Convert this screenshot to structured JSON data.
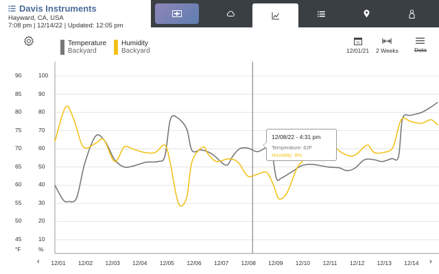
{
  "header": {
    "app_title": "Davis Instruments",
    "location": "Hayward, CA, USA",
    "time": "7:08 pm",
    "date": "12/14/22",
    "updated_label": "Updated: 12:05 pm",
    "sep": "|"
  },
  "nav": {
    "tabs": [
      {
        "icon": "dashboard-icon",
        "active": false
      },
      {
        "icon": "weather-cloud-icon",
        "active": false
      },
      {
        "icon": "graph-icon",
        "active": true
      },
      {
        "icon": "list-icon",
        "active": false
      },
      {
        "icon": "map-pin-icon",
        "active": false
      },
      {
        "icon": "user-icon",
        "active": false
      }
    ]
  },
  "legend": {
    "temperature": {
      "name": "Temperature",
      "location": "Backyard",
      "color": "#777777"
    },
    "humidity": {
      "name": "Humidity",
      "location": "Backyard",
      "color": "#f2c21b"
    }
  },
  "controls": {
    "start_date": "12/01/21",
    "range": "2 Weeks",
    "data_label": "Data"
  },
  "tooltip": {
    "title": "12/08/22 - 4:31 pm",
    "temperature": "Temperature: 62F",
    "humidity": "Humidity: 8%"
  },
  "axes": {
    "temp_unit": "°F",
    "hum_unit": "%"
  },
  "chart_data": {
    "type": "line",
    "x_start": "12/01",
    "x_end": "12/14",
    "categories": [
      "12/01",
      "12/02",
      "12/03",
      "12/04",
      "12/05",
      "12/06",
      "12/07",
      "12/08",
      "12/09",
      "12/10",
      "12/11",
      "12/12",
      "12/13",
      "12/14"
    ],
    "y_left_ticks": [
      45,
      50,
      55,
      60,
      65,
      70,
      75,
      80,
      85,
      90
    ],
    "y_right_ticks": [
      10,
      20,
      30,
      40,
      50,
      60,
      70,
      80,
      90,
      100
    ],
    "ylim_temp": [
      42.5,
      90
    ],
    "ylim_hum": [
      5,
      100
    ],
    "cursor_x": "12/08",
    "series": [
      {
        "name": "Temperature",
        "color": "#777777",
        "points": [
          [
            0,
            60
          ],
          [
            0.3,
            56
          ],
          [
            0.5,
            55.5
          ],
          [
            0.8,
            56.5
          ],
          [
            1.1,
            66
          ],
          [
            1.5,
            73.5
          ],
          [
            1.85,
            72
          ],
          [
            2.2,
            67
          ],
          [
            2.55,
            65
          ],
          [
            2.9,
            65.3
          ],
          [
            3.35,
            66.3
          ],
          [
            3.8,
            66.5
          ],
          [
            4.05,
            68
          ],
          [
            4.25,
            78
          ],
          [
            4.5,
            78.6
          ],
          [
            4.85,
            75.5
          ],
          [
            5.05,
            69.5
          ],
          [
            5.4,
            69.7
          ],
          [
            5.8,
            68.5
          ],
          [
            6.3,
            65.5
          ],
          [
            6.55,
            68
          ],
          [
            6.8,
            70
          ],
          [
            7.1,
            70.2
          ],
          [
            7.45,
            69.2
          ],
          [
            7.7,
            70
          ],
          [
            7.95,
            70.5
          ],
          [
            8.15,
            62
          ],
          [
            8.35,
            62
          ],
          [
            8.75,
            63.8
          ],
          [
            9.1,
            65.4
          ],
          [
            9.5,
            65.7
          ],
          [
            10.05,
            65
          ],
          [
            10.45,
            64.8
          ],
          [
            10.75,
            64
          ],
          [
            11.05,
            64.7
          ],
          [
            11.4,
            67
          ],
          [
            11.75,
            67
          ],
          [
            12.05,
            66.5
          ],
          [
            12.4,
            67.3
          ],
          [
            12.65,
            67.8
          ],
          [
            12.8,
            78.3
          ],
          [
            13.1,
            79.2
          ],
          [
            13.5,
            80
          ],
          [
            13.85,
            81.5
          ],
          [
            14.1,
            82.8
          ]
        ]
      },
      {
        "name": "Humidity",
        "color": "#f2c21b",
        "points": [
          [
            0,
            64
          ],
          [
            0.4,
            83
          ],
          [
            0.7,
            76
          ],
          [
            1.05,
            61
          ],
          [
            1.5,
            63
          ],
          [
            1.8,
            65
          ],
          [
            2.2,
            53
          ],
          [
            2.55,
            61
          ],
          [
            2.85,
            60
          ],
          [
            3.3,
            58
          ],
          [
            3.7,
            58
          ],
          [
            4.05,
            62
          ],
          [
            4.25,
            52
          ],
          [
            4.55,
            30
          ],
          [
            4.85,
            33
          ],
          [
            5.05,
            53
          ],
          [
            5.45,
            61
          ],
          [
            5.65,
            57
          ],
          [
            5.95,
            53
          ],
          [
            6.4,
            54.5
          ],
          [
            6.75,
            52.5
          ],
          [
            7.1,
            45
          ],
          [
            7.45,
            46
          ],
          [
            7.8,
            47
          ],
          [
            8.05,
            40
          ],
          [
            8.25,
            32.5
          ],
          [
            8.55,
            36
          ],
          [
            8.9,
            49
          ],
          [
            9.1,
            53
          ],
          [
            9.45,
            59
          ],
          [
            9.75,
            62
          ],
          [
            10.15,
            62
          ],
          [
            10.55,
            58
          ],
          [
            10.85,
            56
          ],
          [
            11.1,
            57
          ],
          [
            11.5,
            62
          ],
          [
            11.75,
            58
          ],
          [
            12.1,
            58
          ],
          [
            12.45,
            61
          ],
          [
            12.75,
            76
          ],
          [
            13.1,
            75
          ],
          [
            13.5,
            74
          ],
          [
            13.85,
            76
          ],
          [
            14.1,
            73
          ]
        ]
      }
    ]
  }
}
